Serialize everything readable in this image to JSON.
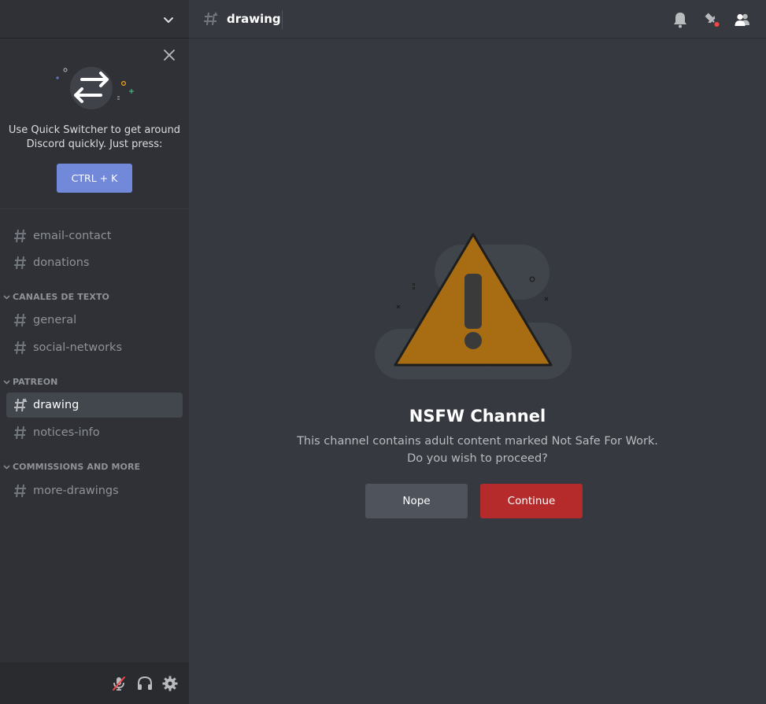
{
  "sidebar": {
    "quick_switcher": {
      "text_line1": "Use Quick Switcher to get around",
      "text_line2": "Discord quickly. Just press:",
      "shortcut_label": "CTRL + K"
    },
    "channels_top": [
      {
        "name": "email-contact"
      },
      {
        "name": "donations"
      }
    ],
    "categories": [
      {
        "label": "CANALES DE TEXTO",
        "channels": [
          {
            "name": "general"
          },
          {
            "name": "social-networks"
          }
        ]
      },
      {
        "label": "PATREON",
        "channels": [
          {
            "name": "drawing",
            "active": true
          },
          {
            "name": "notices-info"
          }
        ]
      },
      {
        "label": "COMMISSIONS AND MORE",
        "channels": [
          {
            "name": "more-drawings"
          }
        ]
      }
    ],
    "user_panel_icons": [
      "microphone-muted-icon",
      "headphones-icon",
      "gear-icon"
    ]
  },
  "header": {
    "channel_name": "drawing",
    "icons": [
      "bell-icon",
      "pin-icon",
      "members-icon"
    ]
  },
  "nsfw_gate": {
    "title": "NSFW Channel",
    "description_line1": "This channel contains adult content marked Not Safe For Work.",
    "description_line2": "Do you wish to proceed?",
    "nope_label": "Nope",
    "continue_label": "Continue"
  },
  "colors": {
    "accent": "#7289da",
    "danger": "#b52a2a",
    "warning": "#a86d12",
    "notification_dot": "#f04747"
  }
}
